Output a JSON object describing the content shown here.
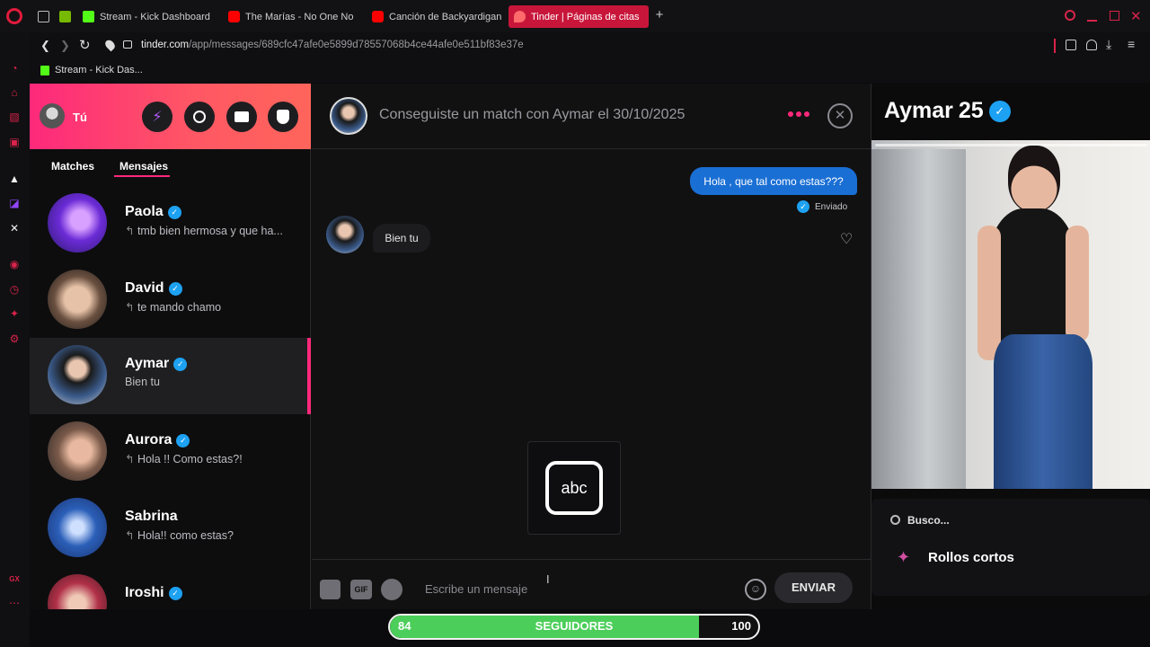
{
  "browser": {
    "tabs": [
      {
        "label": "",
        "icon": "window-icon"
      },
      {
        "label": "",
        "icon": "nvidia-icon"
      },
      {
        "label": "Stream - Kick Dashboard",
        "icon": "kick-icon"
      },
      {
        "label": "The Marías - No One No",
        "icon": "youtube-icon"
      },
      {
        "label": "Canción de Backyardigan",
        "icon": "youtube-icon"
      },
      {
        "label": "Tinder | Páginas de citas",
        "icon": "tinder-icon",
        "active": true
      }
    ],
    "url_host": "tinder.com",
    "url_path": "/app/messages/689cfc47afe0e5899d78557068b4ce44afe0e511bf83e37e",
    "bookmark": "Stream - Kick Das..."
  },
  "left": {
    "user_label": "Tú",
    "tabs": {
      "matches": "Matches",
      "messages": "Mensajes"
    },
    "conversations": [
      {
        "name": "Paola",
        "preview": "tmb bien hermosa y que ha...",
        "replied": true
      },
      {
        "name": "David",
        "preview": "te mando chamo",
        "replied": true
      },
      {
        "name": "Aymar",
        "preview": "Bien tu",
        "replied": false,
        "selected": true
      },
      {
        "name": "Aurora",
        "preview": "Hola !! Como estas?!",
        "replied": true
      },
      {
        "name": "Sabrina",
        "preview": "Hola!! como estas?",
        "replied": true
      },
      {
        "name": "Iroshi",
        "preview": "",
        "replied": false
      }
    ]
  },
  "chat": {
    "header": "Conseguiste un match con Aymar el 30/10/2025",
    "messages": [
      {
        "from": "me",
        "text": "Hola , que tal como estas???",
        "status": "Enviado"
      },
      {
        "from": "them",
        "text": "Bien tu"
      }
    ],
    "abc_label": "abc",
    "input_placeholder": "Escribe un mensaje",
    "gif_label": "GIF",
    "send_label": "ENVIAR"
  },
  "profile": {
    "name": "Aymar",
    "age": "25",
    "looking_for": "Busco...",
    "section": "Rollos cortos"
  },
  "followers": {
    "current": "84",
    "label": "SEGUIDORES",
    "goal": "100",
    "progress": 0.84,
    "color": "#4cce5a"
  },
  "colors": {
    "accent": "#fd297b",
    "send_blue": "#1a6fd4",
    "verified": "#1da1f2"
  }
}
